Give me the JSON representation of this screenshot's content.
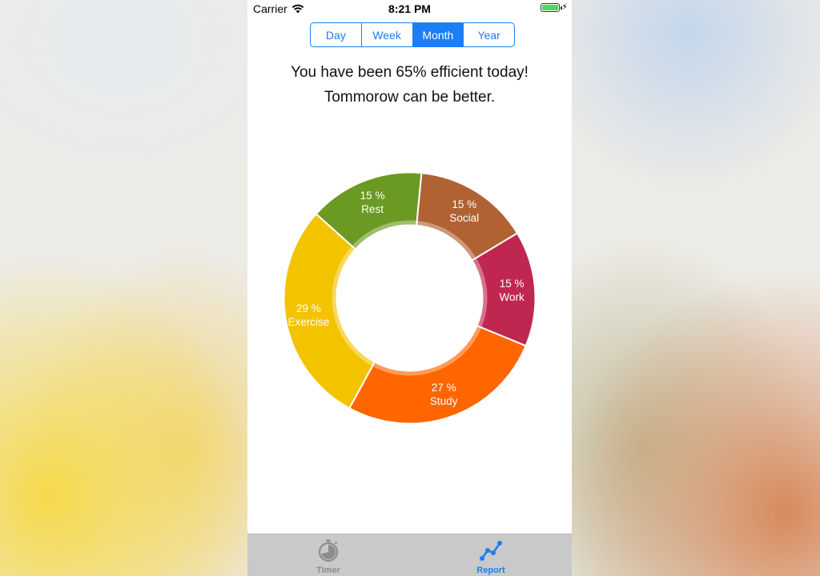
{
  "status_bar": {
    "carrier": "Carrier",
    "time": "8:21 PM"
  },
  "segmented_control": {
    "segments": [
      "Day",
      "Week",
      "Month",
      "Year"
    ],
    "selected": "Month"
  },
  "message": {
    "line1": "You have been 65% efficient today!",
    "line2": "Tommorow can be better."
  },
  "chart_data": {
    "type": "pie",
    "title": "",
    "slices": [
      {
        "label": "Rest",
        "percent_label": "15 %",
        "value": 15,
        "color": "#6b9a23"
      },
      {
        "label": "Social",
        "percent_label": "15 %",
        "value": 15,
        "color": "#b06233"
      },
      {
        "label": "Work",
        "percent_label": "15 %",
        "value": 15,
        "color": "#c02750"
      },
      {
        "label": "Study",
        "percent_label": "27 %",
        "value": 27,
        "color": "#ff6600"
      },
      {
        "label": "Exercise",
        "percent_label": "29 %",
        "value": 29,
        "color": "#f3c300"
      }
    ]
  },
  "tab_bar": {
    "tabs": [
      {
        "label": "Timer",
        "icon": "stopwatch-icon",
        "selected": false
      },
      {
        "label": "Report",
        "icon": "report-chart-icon",
        "selected": true
      }
    ]
  },
  "colors": {
    "accent": "#1a7ef5",
    "tab_bar_background": "#c9c9c9"
  }
}
